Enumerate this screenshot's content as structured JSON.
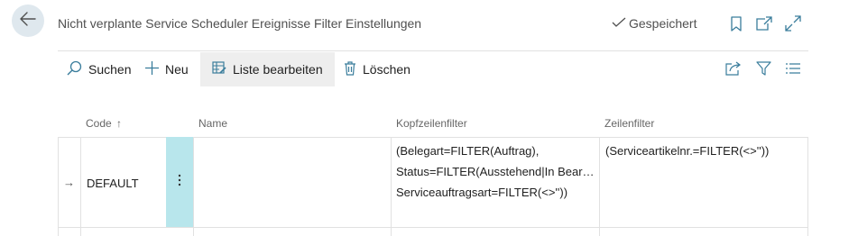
{
  "header": {
    "title": "Nicht verplante Service Scheduler Ereignisse Filter Einstellungen",
    "saved_status": "Gespeichert",
    "icons": [
      "back-arrow-icon",
      "bookmark-icon",
      "open-new-window-icon",
      "expand-icon"
    ]
  },
  "toolbar": {
    "search_label": "Suchen",
    "new_label": "Neu",
    "edit_list_label": "Liste bearbeiten",
    "delete_label": "Löschen",
    "icons": [
      "share-icon",
      "filter-icon",
      "list-view-icon"
    ]
  },
  "table": {
    "columns": {
      "code": "Code",
      "code_sort": "↑",
      "name": "Name",
      "header_filter": "Kopfzeilenfilter",
      "line_filter": "Zeilenfilter"
    },
    "rows": [
      {
        "indicator": "→",
        "code": "DEFAULT",
        "name": "",
        "header_filter_lines": [
          "(Belegart=FILTER(Auftrag),",
          "Status=FILTER(Ausstehend|In Bear…",
          "Serviceauftragsart=FILTER(<>''))"
        ],
        "line_filter": "(Serviceartikelnr.=FILTER(<>''))"
      }
    ]
  },
  "colors": {
    "accent_selected_cell": "#b8e6ec",
    "back_button_bg": "#dfe8ee",
    "active_action_bg": "#eeeeee"
  }
}
